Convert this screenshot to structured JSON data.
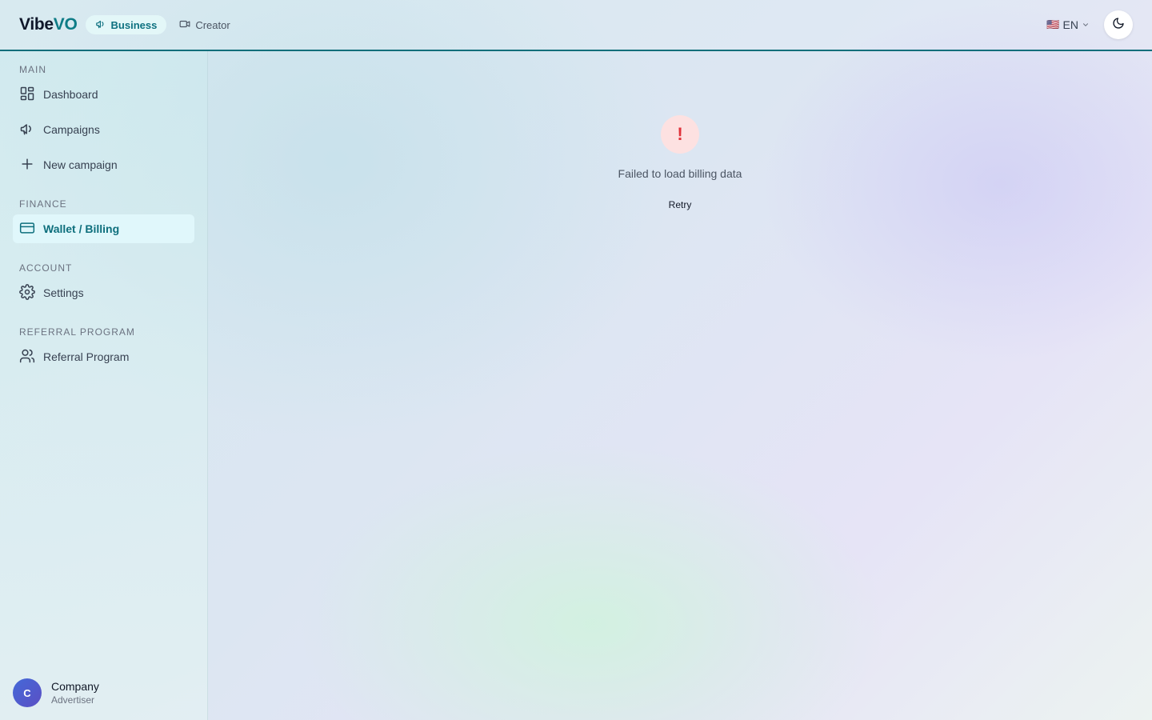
{
  "header": {
    "logo_part1": "Vibe",
    "logo_part2": "VO",
    "mode_tabs": [
      {
        "label": "Business",
        "icon": "megaphone-icon",
        "active": true
      },
      {
        "label": "Creator",
        "icon": "video-icon",
        "active": false
      }
    ],
    "language": {
      "flag": "🇺🇸",
      "code": "EN"
    },
    "theme_toggle_icon": "moon-icon"
  },
  "sidebar": {
    "sections": [
      {
        "label": "MAIN",
        "items": [
          {
            "label": "Dashboard",
            "icon": "grid-icon"
          },
          {
            "label": "Campaigns",
            "icon": "megaphone-icon"
          },
          {
            "label": "New campaign",
            "icon": "plus-icon"
          }
        ]
      },
      {
        "label": "FINANCE",
        "items": [
          {
            "label": "Wallet / Billing",
            "icon": "credit-card-icon",
            "active": true
          }
        ]
      },
      {
        "label": "ACCOUNT",
        "items": [
          {
            "label": "Settings",
            "icon": "gear-icon"
          }
        ]
      },
      {
        "label": "REFERRAL PROGRAM",
        "items": [
          {
            "label": "Referral Program",
            "icon": "users-icon"
          }
        ]
      }
    ],
    "user": {
      "initial": "C",
      "name": "Company",
      "role": "Advertiser"
    }
  },
  "main": {
    "error_icon": "!",
    "error_message": "Failed to load billing data",
    "retry_label": "Retry"
  },
  "colors": {
    "accent": "#0e7c86",
    "active_bg": "#e0f7fb",
    "error": "#e0323a",
    "error_bg": "#fde1e1"
  }
}
